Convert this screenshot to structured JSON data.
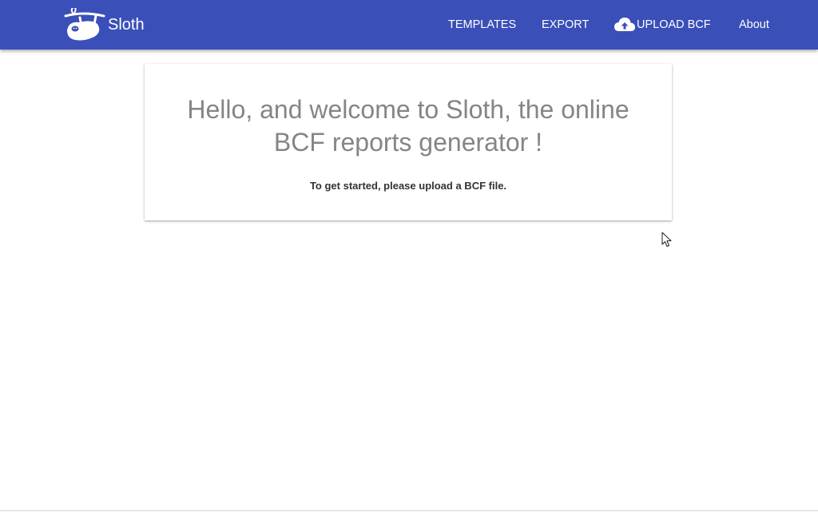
{
  "app": {
    "brand_name": "Sloth",
    "logo_icon": "sloth-logo-icon"
  },
  "nav": {
    "templates": "TEMPLATES",
    "export": "EXPORT",
    "upload": "UPLOAD BCF",
    "upload_icon": "cloud-upload-icon",
    "about": "About"
  },
  "welcome": {
    "heading_line1": "Hello, and welcome to Sloth, the online",
    "heading_line2": "BCF reports generator !",
    "subtitle": "To get started, please upload a BCF file."
  },
  "colors": {
    "appbar": "#3a4fb8",
    "heading": "#858585",
    "subtitle": "#333333"
  }
}
